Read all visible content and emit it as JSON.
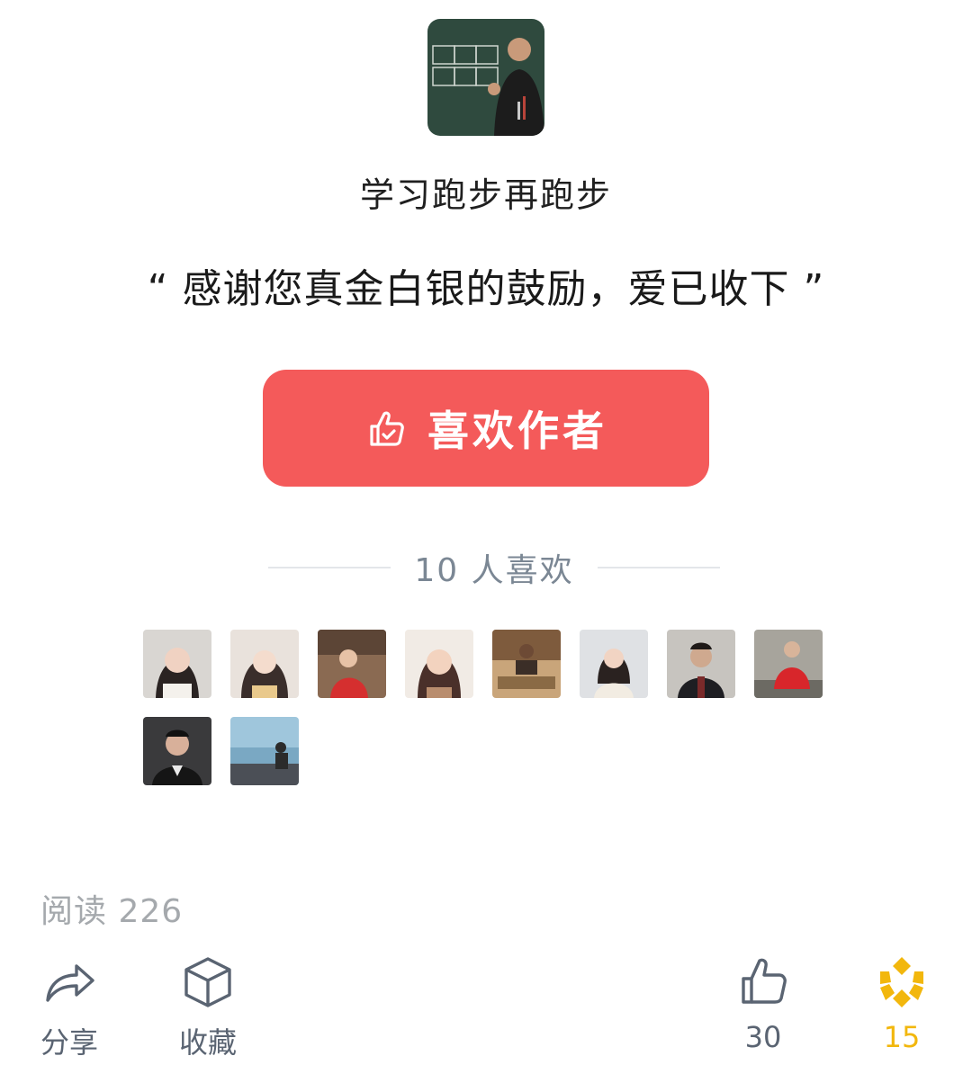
{
  "author": {
    "name": "学习跑步再跑步",
    "avatar_icon": "author-avatar-teacher-at-blackboard"
  },
  "thanks_quote": "“ 感谢您真金白银的鼓励，爱已收下 ”",
  "like_button": {
    "label": "喜欢作者",
    "icon": "thumbs-up-check-icon",
    "color": "#f45a5a"
  },
  "likes": {
    "count_text": "10 人喜欢",
    "supporters": [
      {
        "name": "supporter-1"
      },
      {
        "name": "supporter-2"
      },
      {
        "name": "supporter-3"
      },
      {
        "name": "supporter-4"
      },
      {
        "name": "supporter-5"
      },
      {
        "name": "supporter-6"
      },
      {
        "name": "supporter-7"
      },
      {
        "name": "supporter-8"
      },
      {
        "name": "supporter-9"
      },
      {
        "name": "supporter-10"
      }
    ]
  },
  "read_count": "阅读 226",
  "actions": {
    "share": {
      "label": "分享",
      "icon": "share-arrow-icon"
    },
    "favorite": {
      "label": "收藏",
      "icon": "cube-icon"
    },
    "like": {
      "count": "30",
      "icon": "thumbs-up-icon"
    },
    "reward": {
      "count": "15",
      "icon": "gold-diamond-icon",
      "color": "#f2b70d"
    }
  }
}
